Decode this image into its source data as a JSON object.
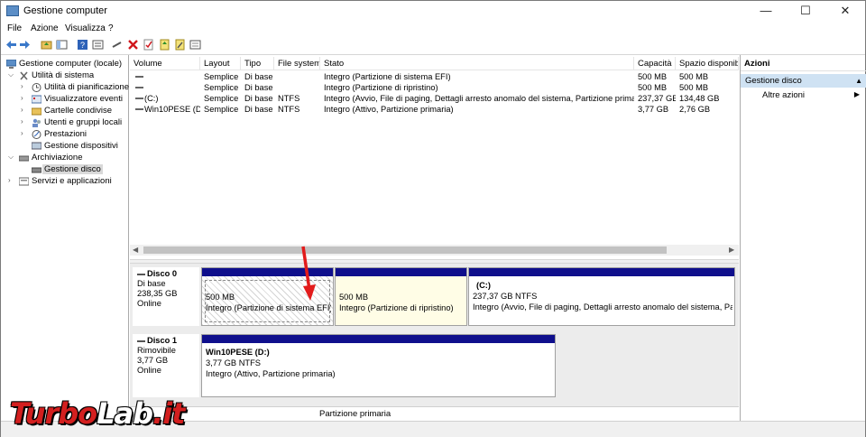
{
  "window": {
    "title": "Gestione computer",
    "controls": {
      "minimize": "—",
      "maximize": "☐",
      "close": "✕"
    }
  },
  "menubar": {
    "items": [
      "File",
      "Azione",
      "Visualizza",
      "?"
    ]
  },
  "tree": {
    "items": [
      {
        "label": "Gestione computer (locale)",
        "icon": "computer-management-icon"
      },
      {
        "label": "Utilità di sistema",
        "icon": "system-tools-icon"
      },
      {
        "label": "Utilità di pianificazione",
        "icon": "task-scheduler-icon"
      },
      {
        "label": "Visualizzatore eventi",
        "icon": "event-viewer-icon"
      },
      {
        "label": "Cartelle condivise",
        "icon": "shared-folders-icon"
      },
      {
        "label": "Utenti e gruppi locali",
        "icon": "users-groups-icon"
      },
      {
        "label": "Prestazioni",
        "icon": "performance-icon"
      },
      {
        "label": "Gestione dispositivi",
        "icon": "device-manager-icon"
      },
      {
        "label": "Archiviazione",
        "icon": "storage-icon"
      },
      {
        "label": "Gestione disco",
        "icon": "disk-management-icon"
      },
      {
        "label": "Servizi e applicazioni",
        "icon": "services-applications-icon"
      }
    ]
  },
  "volumes": {
    "columns": [
      "Volume",
      "Layout",
      "Tipo",
      "File system",
      "Stato",
      "Capacità",
      "Spazio disponibi"
    ],
    "rows": [
      {
        "volume": "",
        "layout": "Semplice",
        "tipo": "Di base",
        "fs": "",
        "stato": "Integro (Partizione di sistema EFI)",
        "cap": "500 MB",
        "free": "500 MB"
      },
      {
        "volume": "",
        "layout": "Semplice",
        "tipo": "Di base",
        "fs": "",
        "stato": "Integro (Partizione di ripristino)",
        "cap": "500 MB",
        "free": "500 MB"
      },
      {
        "volume": "(C:)",
        "layout": "Semplice",
        "tipo": "Di base",
        "fs": "NTFS",
        "stato": "Integro (Avvio, File di paging, Dettagli arresto anomalo del sistema, Partizione primaria)",
        "cap": "237,37 GB",
        "free": "134,48 GB"
      },
      {
        "volume": "Win10PESE (D:)",
        "layout": "Semplice",
        "tipo": "Di base",
        "fs": "NTFS",
        "stato": "Integro (Attivo, Partizione primaria)",
        "cap": "3,77 GB",
        "free": "2,76 GB"
      }
    ]
  },
  "disks": [
    {
      "name": "Disco 0",
      "type": "Di base",
      "size": "238,35 GB",
      "status": "Online",
      "partitions": [
        {
          "title": "",
          "size": "500 MB",
          "status": "Integro (Partizione di sistema EFI)"
        },
        {
          "title": "",
          "size": "500 MB",
          "status": "Integro (Partizione di ripristino)"
        },
        {
          "title": "(C:)",
          "size": "237,37 GB NTFS",
          "status": "Integro (Avvio, File di paging, Dettagli arresto anomalo del sistema, Partiz"
        }
      ]
    },
    {
      "name": "Disco 1",
      "type": "Rimovibile",
      "size": "3,77 GB",
      "status": "Online",
      "partitions": [
        {
          "title": "Win10PESE  (D:)",
          "size": "3,77 GB NTFS",
          "status": "Integro (Attivo, Partizione primaria)"
        }
      ]
    }
  ],
  "legend": {
    "label": "Partizione primaria"
  },
  "actions": {
    "header": "Azioni",
    "section": "Gestione disco",
    "item": "Altre azioni"
  },
  "watermark": {
    "text": "TurboLab.it"
  },
  "colors": {
    "partition_bar": "#0f0f8c",
    "selection": "#cfe2f3",
    "arrow": "#e21b1b"
  }
}
